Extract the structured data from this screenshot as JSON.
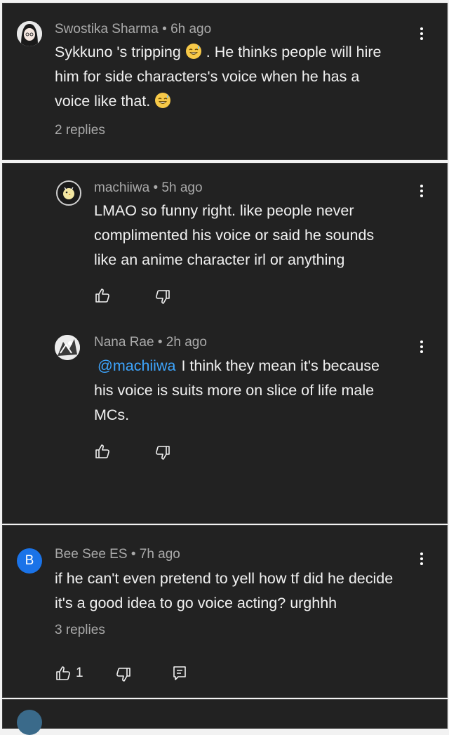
{
  "comments": [
    {
      "author": "Swostika Sharma",
      "time": "6h ago",
      "lines": [
        "Sykkuno 's tripping",
        ". He thinks people will hire",
        "him for side characters's voice when he has a",
        "voice like that."
      ],
      "replies": "2 replies",
      "avatar_icon": "anime-girl-avatar"
    },
    {
      "author": "machiiwa",
      "time": "5h ago",
      "lines": [
        "LMAO so funny right. like people never",
        "complimented his voice or said he sounds",
        "like an anime character irl or anything"
      ],
      "avatar_icon": "chick-avatar"
    },
    {
      "author": "Nana Rae",
      "time": "2h ago",
      "mention": "@machiiwa",
      "lines": [
        "I think they mean it's because",
        "his voice is suits more on slice of life male",
        "MCs."
      ],
      "avatar_icon": "sketch-avatar"
    },
    {
      "author": "Bee See ES",
      "time": "7h ago",
      "avatar_letter": "B",
      "avatar_color": "#1a73e8",
      "lines": [
        "if he can't even pretend to yell how tf did he decide",
        "it's a good idea to go voice acting? urghhh"
      ],
      "replies": "3 replies",
      "like_count": "1"
    }
  ],
  "separator": "•"
}
